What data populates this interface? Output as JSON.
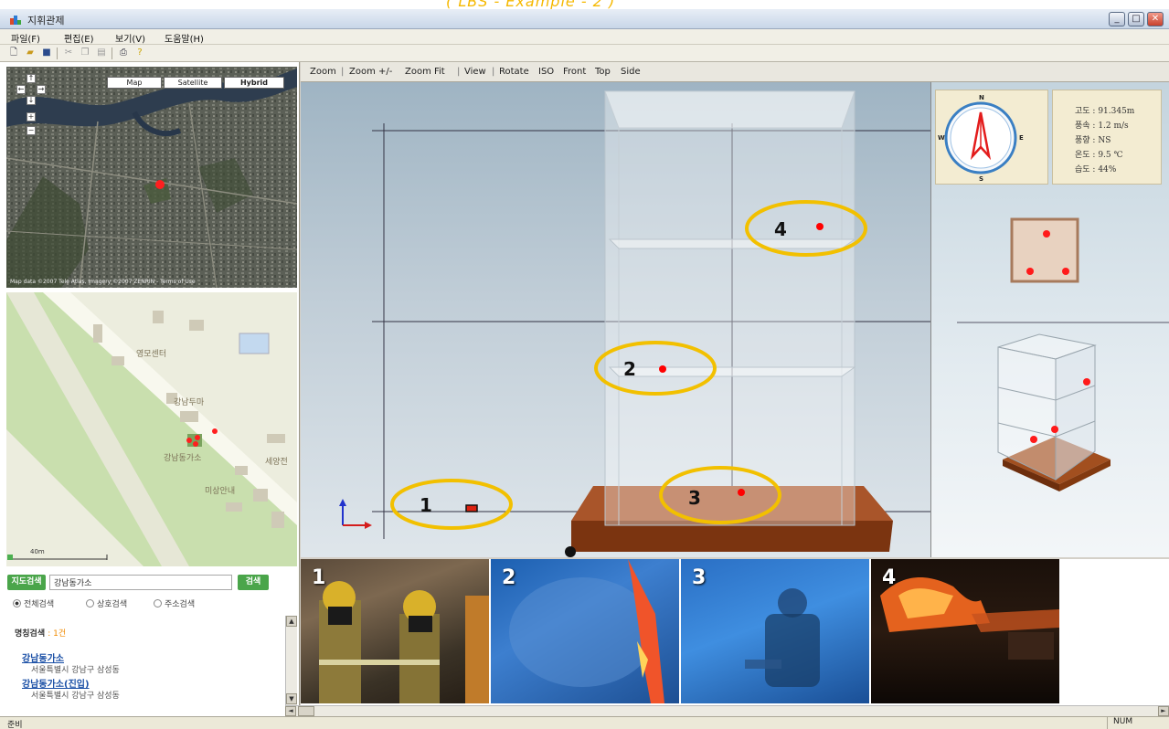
{
  "banner": {
    "text": "( LBS - Example - 2 )"
  },
  "window": {
    "title": "지휘관제",
    "min": "_",
    "max": "□",
    "close": "✕"
  },
  "menu": [
    "파일(F)",
    "편집(E)",
    "보기(V)",
    "도움말(H)"
  ],
  "satellite_map": {
    "types": [
      "Map",
      "Satellite",
      "Hybrid"
    ],
    "active_type": "Hybrid",
    "controls": [
      "↑",
      "←",
      "→",
      "↓",
      "+",
      "−"
    ],
    "copyright": "Map data ©2007 Tele Atlas, Imagery ©2007 ZENRIN - Terms of Use"
  },
  "street_map": {
    "labels": [
      "영모센터",
      "강남두마",
      "강남동가소",
      "미상안내",
      "세양전"
    ],
    "scale": "40m"
  },
  "search": {
    "button": "지도검색",
    "input_value": "강남동가소",
    "go": "검색",
    "options": [
      "전체검색",
      "상호검색",
      "주소검색"
    ],
    "selected_option": 0
  },
  "results": {
    "header": "명칭검색",
    "count": ": 1건",
    "items": [
      {
        "title": "강남동가소",
        "address": "서울특별시 강남구 삼성동"
      },
      {
        "title": "강남동가소(진입)",
        "address": "서울특별시 강남구 삼성동"
      }
    ]
  },
  "viewer_toolbar": [
    "Zoom",
    "|",
    "Zoom +/-",
    "Zoom Fit",
    "|",
    "View",
    "|",
    "Rotate",
    "ISO",
    "Front",
    "Top",
    "Side"
  ],
  "markers": [
    "1",
    "2",
    "3",
    "4"
  ],
  "weather": {
    "lines": [
      "고도 : 91.345m",
      "풍속 : 1.2 m/s",
      "풍향 : NS",
      "온도 : 9.5 ℃",
      "습도 : 44%"
    ]
  },
  "compass": {
    "n": "N",
    "s": "S",
    "e": "E",
    "w": "W"
  },
  "photos": [
    "1",
    "2",
    "3",
    "4"
  ],
  "status": {
    "left": "준비",
    "num": "NUM"
  },
  "colors": {
    "marker_ring": "#f2c000",
    "marker_dot": "#ff0000",
    "search_green": "#4aa54a"
  }
}
